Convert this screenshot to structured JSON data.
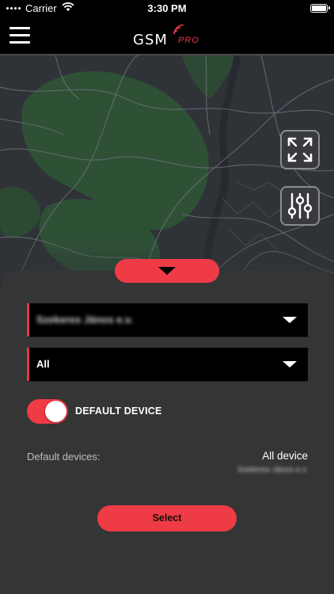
{
  "status_bar": {
    "carrier": "Carrier",
    "time": "3:30 PM",
    "icons": [
      "wifi-icon",
      "battery-icon"
    ]
  },
  "nav": {
    "menu_icon": "hamburger-menu-icon",
    "logo_text": "GSM",
    "logo_suffix": "PRO"
  },
  "map": {
    "buttons": [
      "fullscreen-icon",
      "sliders-icon"
    ]
  },
  "panel": {
    "collapse_icon": "chevron-down-icon",
    "customer_dropdown": {
      "value": "Szekeres János e.v."
    },
    "group_dropdown": {
      "value": "All"
    },
    "default_toggle": {
      "label": "DEFAULT DEVICE",
      "on": true
    },
    "default_devices": {
      "label": "Default devices:",
      "value": "All device",
      "sub": "Szekeres János e.v."
    },
    "select_label": "Select"
  },
  "colors": {
    "accent": "#ef3b46",
    "panel_bg": "#353535",
    "map_bg": "#2f3338",
    "map_park": "#2e5136"
  }
}
